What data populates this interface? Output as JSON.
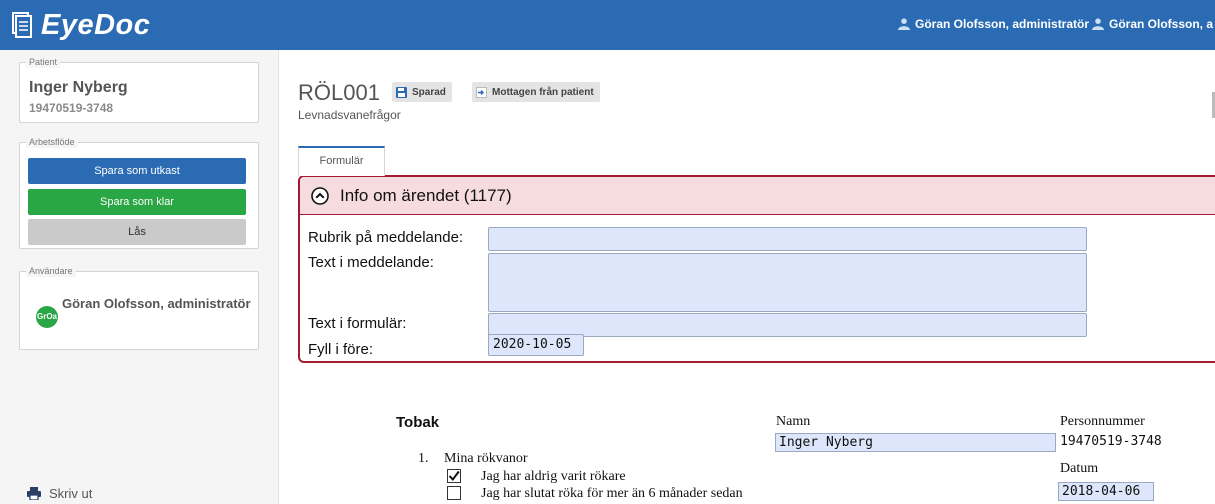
{
  "app": {
    "name": "EyeDoc"
  },
  "header": {
    "users": [
      "Göran Olofsson, administratör",
      "Göran Olofsson, a"
    ]
  },
  "sidebar": {
    "patient": {
      "legend": "Patient",
      "name": "Inger Nyberg",
      "id": "19470519-3748"
    },
    "workflow": {
      "legend": "Arbetsflöde",
      "save_draft": "Spara som utkast",
      "save_done": "Spara som klar",
      "lock": "Lås"
    },
    "user": {
      "legend": "Användare",
      "initials": "GrOa",
      "name": "Göran Olofsson, administratör"
    },
    "print": "Skriv ut"
  },
  "main": {
    "form_code": "RÖL001",
    "status_saved": "Sparad",
    "status_received": "Mottagen från patient",
    "subtitle": "Levnadsvanefrågor",
    "tab": "Formulär",
    "info": {
      "title": "Info om ärendet (1177)",
      "labels": {
        "subject": "Rubrik på meddelande:",
        "message": "Text i meddelande:",
        "form_text": "Text i formulär:",
        "due": "Fyll i före:"
      },
      "values": {
        "subject": "",
        "message": "",
        "form_text": "",
        "due": "2020-10-05"
      }
    },
    "questionnaire": {
      "title": "Tobak",
      "name_label": "Namn",
      "name_value": "Inger Nyberg",
      "pnr_label": "Personnummer",
      "pnr_value": "19470519-3748",
      "date_label": "Datum",
      "date_value": "2018-04-06",
      "q1_number": "1.",
      "q1_text": "Mina rökvanor",
      "options": [
        {
          "label": "Jag har aldrig varit rökare",
          "checked": true
        },
        {
          "label": "Jag har slutat röka för mer än 6 månader sedan",
          "checked": false
        }
      ]
    }
  }
}
